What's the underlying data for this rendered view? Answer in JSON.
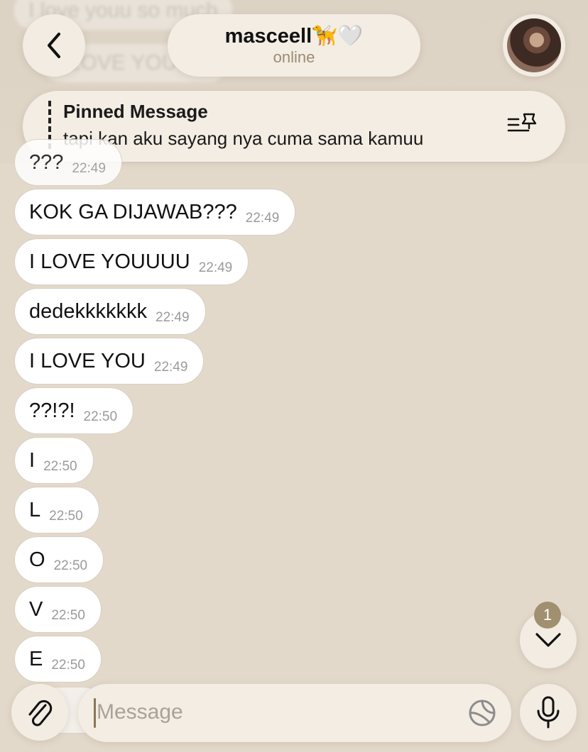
{
  "header": {
    "back_label": "back",
    "contact_name": "masceell🦮🤍",
    "status": "online"
  },
  "pinned": {
    "title": "Pinned Message",
    "text": "tapi kan aku sayang nya cuma sama kamuu"
  },
  "background_messages": [
    {
      "text": "I love youu so much"
    },
    {
      "text": "I LOVE YOU???"
    }
  ],
  "messages": [
    {
      "text": "???",
      "time": "22:49"
    },
    {
      "text": "KOK GA DIJAWAB???",
      "time": "22:49"
    },
    {
      "text": "I LOVE YOUUUU",
      "time": "22:49"
    },
    {
      "text": "dedekkkkkkk",
      "time": "22:49"
    },
    {
      "text": "I LOVE YOU",
      "time": "22:49"
    },
    {
      "text": "??!?!",
      "time": "22:50"
    },
    {
      "text": "I",
      "time": "22:50"
    },
    {
      "text": "L",
      "time": "22:50"
    },
    {
      "text": "O",
      "time": "22:50"
    },
    {
      "text": "V",
      "time": "22:50"
    },
    {
      "text": "E",
      "time": "22:50"
    }
  ],
  "scroll_down": {
    "badge_count": "1"
  },
  "composer": {
    "placeholder": "Message"
  },
  "colors": {
    "background": "#e3d9cb",
    "accent": "#9c8c72",
    "badge": "#a09070"
  }
}
